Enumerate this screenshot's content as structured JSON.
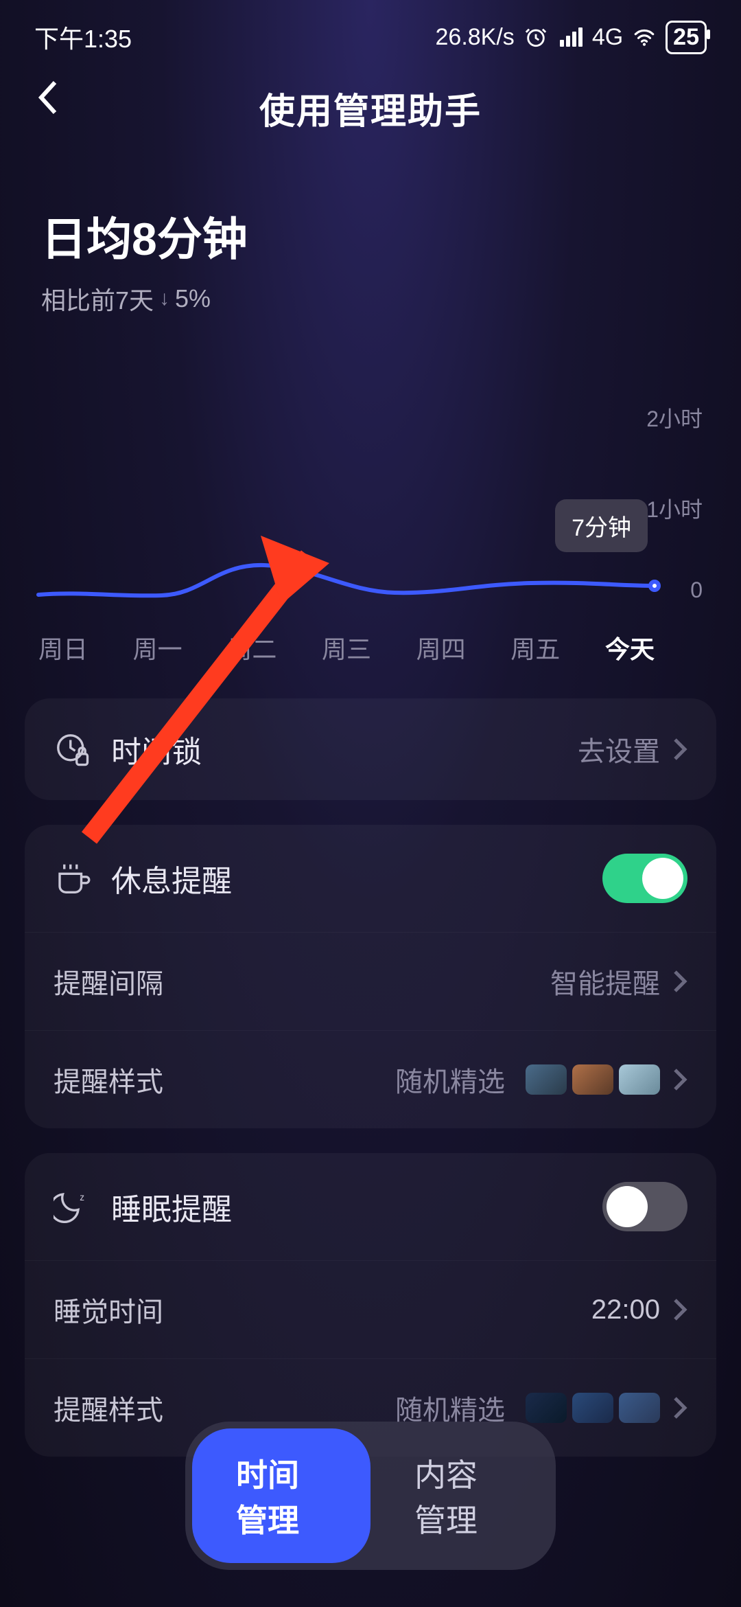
{
  "status": {
    "time": "下午1:35",
    "speed": "26.8K/s",
    "network": "4G",
    "battery": "25"
  },
  "header": {
    "title": "使用管理助手"
  },
  "summary": {
    "heading": "日均8分钟",
    "compare_prefix": "相比前7天",
    "compare_delta": "5%"
  },
  "chart_data": {
    "type": "line",
    "categories": [
      "周日",
      "周一",
      "周二",
      "周三",
      "周四",
      "周五",
      "今天"
    ],
    "values": [
      10,
      8,
      25,
      12,
      8,
      10,
      7
    ],
    "ylabel": "",
    "ylim": [
      0,
      120
    ],
    "y_ticks": [
      "2小时",
      "1小时",
      "0"
    ],
    "tooltip_index": 6,
    "tooltip_label": "7分钟",
    "active_index": 6
  },
  "cards": {
    "time_lock": {
      "label": "时间锁",
      "action": "去设置"
    },
    "rest_reminder": {
      "label": "休息提醒",
      "enabled": true,
      "interval_key": "提醒间隔",
      "interval_value": "智能提醒",
      "style_key": "提醒样式",
      "style_value": "随机精选"
    },
    "sleep_reminder": {
      "label": "睡眠提醒",
      "enabled": false,
      "time_key": "睡觉时间",
      "time_value": "22:00",
      "style_key": "提醒样式",
      "style_value": "随机精选"
    }
  },
  "tabs": {
    "time": "时间管理",
    "content": "内容管理",
    "active": "time"
  }
}
